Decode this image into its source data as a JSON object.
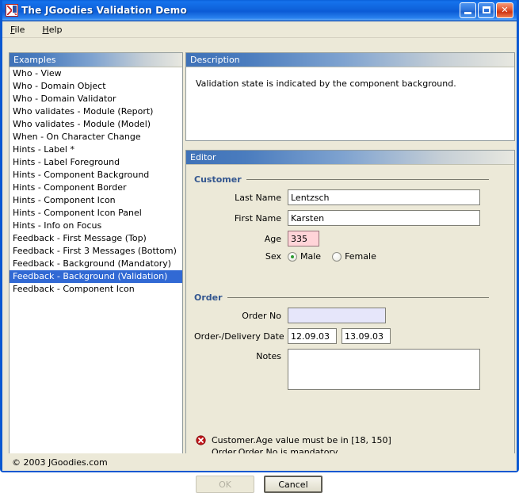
{
  "window": {
    "title": "The JGoodies Validation Demo",
    "icon": "app-icon",
    "minimize_label": "Minimize",
    "maximize_label": "Maximize",
    "close_label": "✕"
  },
  "menubar": {
    "items": [
      {
        "label": "File",
        "mnemonic": "F"
      },
      {
        "label": "Help",
        "mnemonic": "H"
      }
    ]
  },
  "examples": {
    "header": "Examples",
    "selected_index": 16,
    "items": [
      "Who - View",
      "Who - Domain Object",
      "Who - Domain Validator",
      "Who validates - Module (Report)",
      "Who validates - Module (Model)",
      "When - On Character Change",
      "Hints - Label *",
      "Hints - Label Foreground",
      "Hints - Component Background",
      "Hints - Component Border",
      "Hints - Component Icon",
      "Hints - Component Icon Panel",
      "Hints - Info on Focus",
      "Feedback - First Message (Top)",
      "Feedback - First 3 Messages (Bottom)",
      "Feedback - Background (Mandatory)",
      "Feedback - Background (Validation)",
      "Feedback - Component Icon"
    ]
  },
  "description": {
    "header": "Description",
    "text": "Validation state is indicated by the component background."
  },
  "editor": {
    "header": "Editor",
    "customer": {
      "section_title": "Customer",
      "last_name_label": "Last Name",
      "last_name_value": "Lentzsch",
      "first_name_label": "First Name",
      "first_name_value": "Karsten",
      "age_label": "Age",
      "age_value": "335",
      "sex_label": "Sex",
      "sex_male_label": "Male",
      "sex_female_label": "Female",
      "sex_selected": "Male"
    },
    "order": {
      "section_title": "Order",
      "order_no_label": "Order No",
      "order_no_value": "",
      "order_no_placeholder": "",
      "dates_label": "Order-/Delivery Date",
      "order_date_value": "12.09.03",
      "delivery_date_value": "13.09.03",
      "notes_label": "Notes",
      "notes_value": ""
    },
    "messages": {
      "icon": "error-icon",
      "line1": "Customer.Age value must be in [18, 150]",
      "line2": "Order.Order No is mandatory"
    },
    "buttons": {
      "ok_label": "OK",
      "cancel_label": "Cancel"
    }
  },
  "statusbar": {
    "copyright": "© 2003 JGoodies.com"
  },
  "colors": {
    "title_blue": "#0b5bd6",
    "panel_header_blue": "#3f72b8",
    "selection_blue": "#3169d4",
    "section_title_blue": "#33568f",
    "desktop_bg": "#ece9d8",
    "error_red": "#c4171b",
    "invalid_field_bg": "#ffd4d8",
    "mandatory_field_bg": "#e6e6fa",
    "radio_dot_green": "#2e9b32"
  }
}
